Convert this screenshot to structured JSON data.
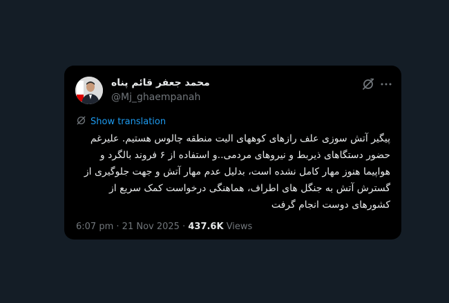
{
  "tweet": {
    "display_name": "محمد جعفر قائم پناه",
    "handle": "@Mj_ghaempanah",
    "translation_label": "Show translation",
    "text": "پیگیر آتش سوزی علف رازهای کوههای الیت منطقه چالوس هستیم. علیرغم حضور دستگاهای ذیربط و نیروهای مردمی..و استفاده از ۶ فروند بالگرد و هواپیما هنوز مهار کامل نشده است، بدلیل عدم مهار آتش و جهت جلوگیری از گسترش آتش به جنگل های اطراف، هماهنگی درخواست کمک سریع از کشورهای دوست انجام گرفت",
    "time": "6:07 pm",
    "separator": "·",
    "date": "21 Nov 2025",
    "views_count": "437.6K",
    "views_label": "Views"
  },
  "colors": {
    "background": "#141d26",
    "card": "#000000",
    "text_primary": "#e7e9ea",
    "text_secondary": "#71767b",
    "link": "#1d9bf0"
  },
  "icons": {
    "grok": "grok-icon",
    "more": "more-icon",
    "translate": "translate-icon",
    "avatar": "avatar"
  }
}
